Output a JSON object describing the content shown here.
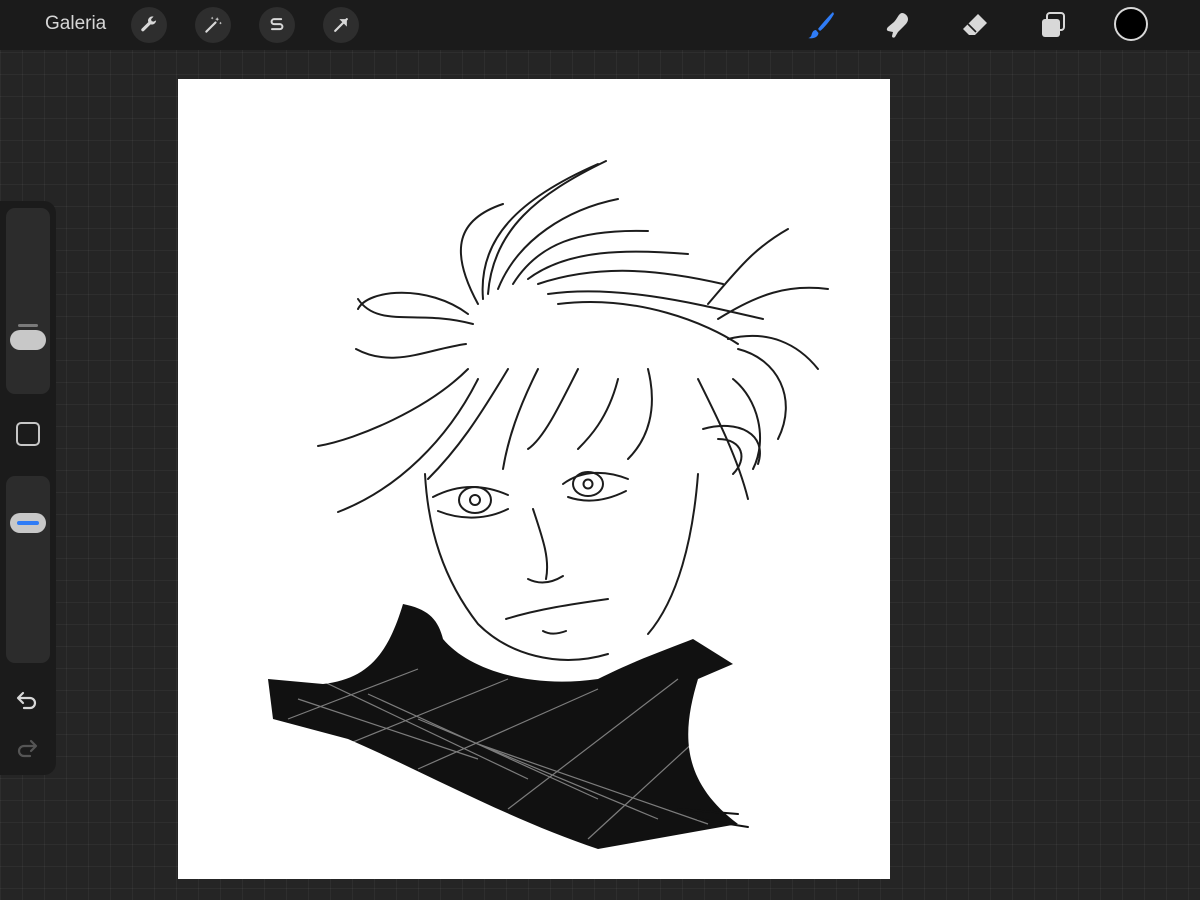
{
  "topbar": {
    "gallery_label": "Galeria",
    "actions_icon": "wrench-icon",
    "adjustments_icon": "magic-wand-icon",
    "selection_icon": "selection-s-icon",
    "transform_icon": "arrow-cursor-icon",
    "brush_icon": "brush-icon",
    "smudge_icon": "smudge-icon",
    "eraser_icon": "eraser-icon",
    "layers_icon": "layers-icon",
    "active_tool": "brush",
    "active_color": "#000000",
    "accent_color": "#2f7cf6"
  },
  "sidebar": {
    "brush_size_level": 0.25,
    "opacity_level": 0.2,
    "modify_icon": "square-icon",
    "undo_icon": "undo-arrow-icon",
    "redo_icon": "redo-arrow-icon"
  }
}
